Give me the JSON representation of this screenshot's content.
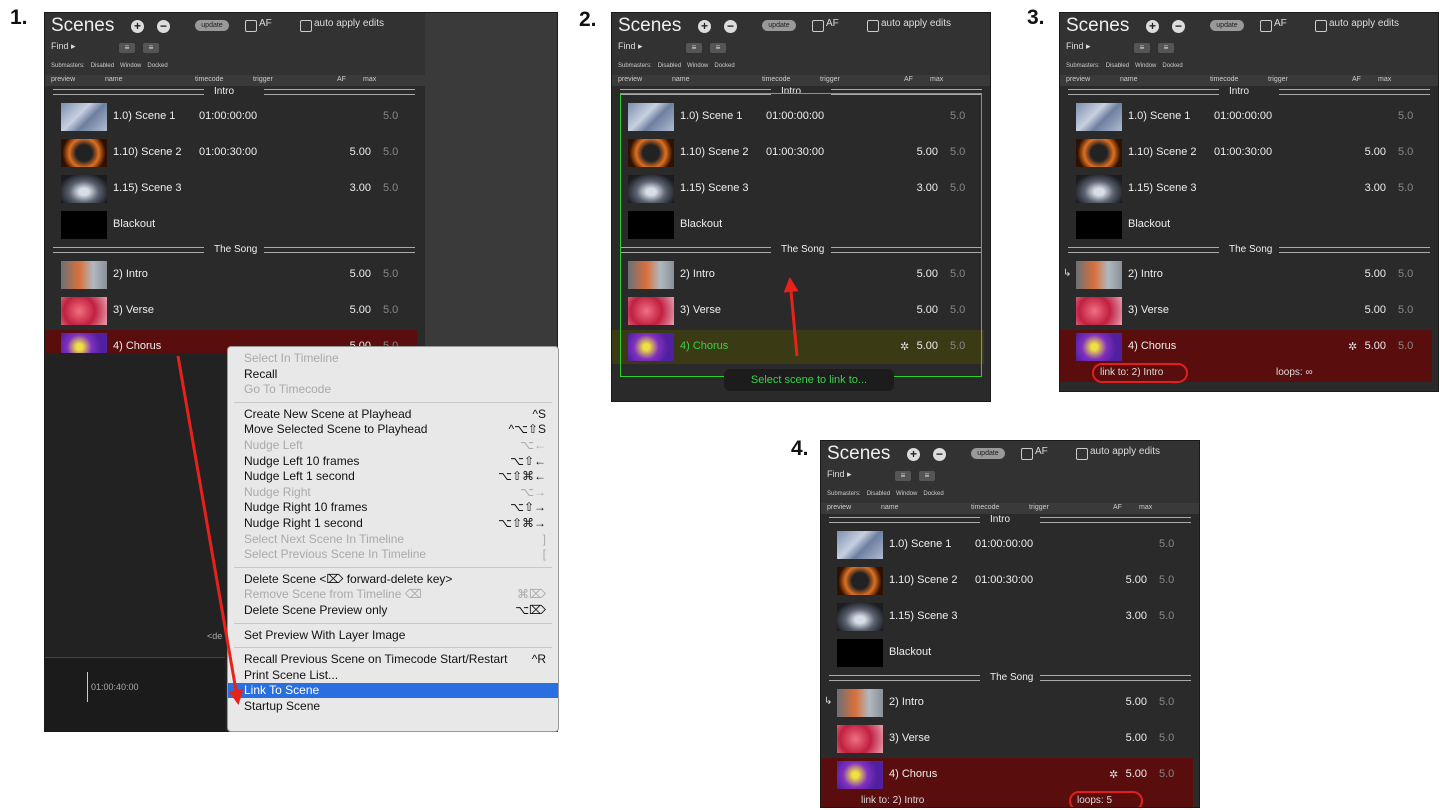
{
  "steps": [
    "1.",
    "2.",
    "3.",
    "4."
  ],
  "panel": {
    "title": "Scenes",
    "add_icon": "+",
    "remove_icon": "−",
    "update_label": "update",
    "af_label": "AF",
    "auto_apply_label": "auto apply edits",
    "find_label": "Find ▸",
    "submasters_label": "Submasters:",
    "disabled_label": "Disabled",
    "window_label": "Window",
    "docked_label": "Docked",
    "columns": [
      "preview",
      "name",
      "timecode",
      "trigger",
      "AF",
      "max"
    ]
  },
  "groups": [
    "Intro",
    "The Song"
  ],
  "scenes": [
    {
      "name": "1.0) Scene 1",
      "timecode": "01:00:00:00",
      "af": "",
      "max": "5.0",
      "thumb": "s1"
    },
    {
      "name": "1.10) Scene 2",
      "timecode": "01:00:30:00",
      "af": "5.00",
      "max": "5.0",
      "thumb": "s2"
    },
    {
      "name": "1.15) Scene 3",
      "timecode": "",
      "af": "3.00",
      "max": "5.0",
      "thumb": "s3"
    },
    {
      "name": "Blackout",
      "timecode": "",
      "af": "",
      "max": "",
      "thumb": "bk"
    },
    {
      "name": "2) Intro",
      "timecode": "",
      "af": "5.00",
      "max": "5.0",
      "thumb": "in"
    },
    {
      "name": "3) Verse",
      "timecode": "",
      "af": "5.00",
      "max": "5.0",
      "thumb": "vs"
    },
    {
      "name": "4) Chorus",
      "timecode": "",
      "af": "5.00",
      "max": "5.0",
      "thumb": "ch"
    }
  ],
  "gear_icon": "✲",
  "link_arrow_icon": "↳",
  "timeline": {
    "timecode": "01:00:40:00",
    "partial_text": "<de"
  },
  "context_menu": [
    {
      "label": "Select In Timeline",
      "key": "",
      "disabled": true
    },
    {
      "label": "Recall",
      "key": "",
      "disabled": false
    },
    {
      "label": "Go To Timecode",
      "key": "",
      "disabled": true
    },
    {
      "sep": true
    },
    {
      "label": "Create New Scene at Playhead",
      "key": "^S",
      "disabled": false
    },
    {
      "label": "Move Selected Scene to Playhead",
      "key": "^⌥⇧S",
      "disabled": false
    },
    {
      "label": "Nudge Left",
      "key": "⌥←",
      "disabled": true
    },
    {
      "label": "Nudge Left 10 frames",
      "key": "⌥⇧←",
      "disabled": false
    },
    {
      "label": "Nudge Left 1 second",
      "key": "⌥⇧⌘←",
      "disabled": false
    },
    {
      "label": "Nudge Right",
      "key": "⌥→",
      "disabled": true
    },
    {
      "label": "Nudge Right 10 frames",
      "key": "⌥⇧→",
      "disabled": false
    },
    {
      "label": "Nudge Right 1 second",
      "key": "⌥⇧⌘→",
      "disabled": false
    },
    {
      "label": "Select Next Scene In Timeline",
      "key": "]",
      "disabled": true
    },
    {
      "label": "Select Previous Scene In Timeline",
      "key": "[",
      "disabled": true
    },
    {
      "sep": true
    },
    {
      "label": "Delete Scene <⌦ forward-delete key>",
      "key": "",
      "disabled": false
    },
    {
      "label": "Remove Scene from Timeline ⌫",
      "key": "⌘⌦",
      "disabled": true
    },
    {
      "label": "Delete Scene Preview only",
      "key": "⌥⌦",
      "disabled": false
    },
    {
      "sep": true
    },
    {
      "label": "Set Preview With Layer Image",
      "key": "",
      "disabled": false
    },
    {
      "sep": true
    },
    {
      "label": "Recall Previous Scene on Timecode Start/Restart",
      "key": "^R",
      "disabled": false
    },
    {
      "label": "Print Scene List...",
      "key": "",
      "disabled": false
    },
    {
      "label": "Link To Scene",
      "key": "",
      "disabled": false,
      "highlight": true
    },
    {
      "label": "Startup Scene",
      "key": "",
      "disabled": false
    }
  ],
  "step2_toast": "Select scene to link to...",
  "step3": {
    "link_to": "link to: 2) Intro",
    "loops": "loops: ∞"
  },
  "step4": {
    "link_to": "link to: 2) Intro",
    "loops": "loops: 5"
  },
  "colors": {
    "arrow": "#e8221a",
    "selected_row": "#5a0d0d",
    "green": "#2ed12a",
    "menu_highlight": "#2a6fe0"
  }
}
